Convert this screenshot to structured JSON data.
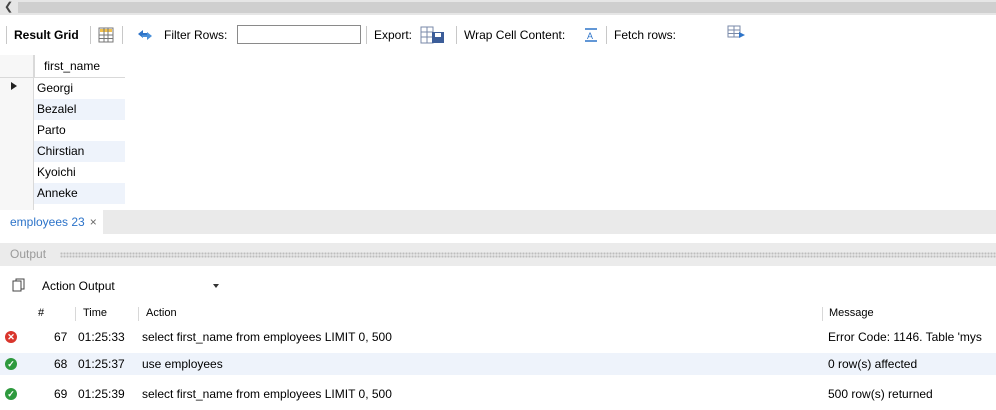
{
  "result_toolbar": {
    "result_grid_label": "Result Grid",
    "filter_label": "Filter Rows:",
    "filter_value": "",
    "export_label": "Export:",
    "wrap_label": "Wrap Cell Content:",
    "fetch_label": "Fetch rows:"
  },
  "grid": {
    "column_header": "first_name",
    "rows": [
      "Georgi",
      "Bezalel",
      "Parto",
      "Chirstian",
      "Kyoichi",
      "Anneke"
    ]
  },
  "tab": {
    "label": "employees 23",
    "close_glyph": "×"
  },
  "output": {
    "title": "Output",
    "selector_value": "Action Output",
    "columns": {
      "num": "#",
      "time": "Time",
      "action": "Action",
      "message": "Message"
    },
    "rows": [
      {
        "status": "error",
        "num": "67",
        "time": "01:25:33",
        "action": "select first_name from employees LIMIT 0, 500",
        "message": "Error Code: 1146. Table 'mys"
      },
      {
        "status": "ok",
        "num": "68",
        "time": "01:25:37",
        "action": "use employees",
        "message": "0 row(s) affected"
      },
      {
        "status": "ok",
        "num": "69",
        "time": "01:25:39",
        "action": "select first_name from employees LIMIT 0, 500",
        "message": "500 row(s) returned"
      }
    ]
  },
  "colors": {
    "error": "#d9352c",
    "success": "#2e9a3e",
    "tab_text": "#2c73c9",
    "alt_row": "#eef3fb"
  }
}
